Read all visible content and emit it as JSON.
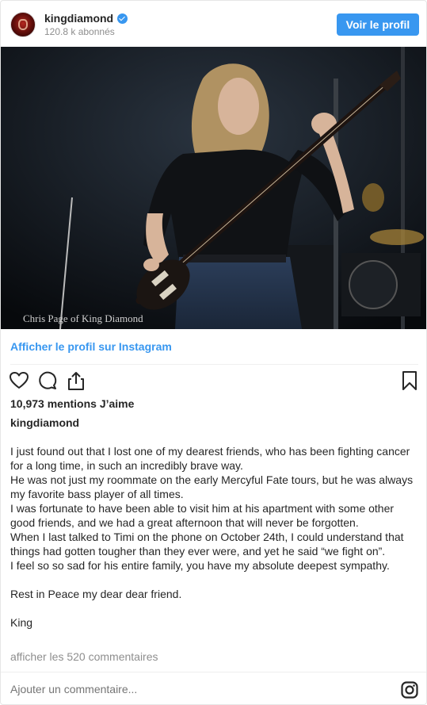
{
  "header": {
    "username": "kingdiamond",
    "followers": "120.8 k abonnés",
    "profile_button": "Voir le profil"
  },
  "photo": {
    "caption": "Chris Page of King Diamond"
  },
  "links": {
    "view_on_instagram": "Afficher le profil sur Instagram"
  },
  "engagement": {
    "likes": "10,973 mentions J’aime"
  },
  "post": {
    "username": "kingdiamond",
    "paragraphs": [
      "I just found out that I lost one of my dearest friends, who has been fighting cancer for a long time, in such an incredibly brave way.",
      "He was not just my roommate on the early Mercyful Fate tours, but he was always my favorite bass player of all times.",
      "I was fortunate to have been able to visit him at his apartment with some other good friends, and we had a great afternoon that will never be forgotten.",
      "When I last talked to Timi on the phone on October 24th, I could understand that things had gotten tougher than they ever were, and yet he said “we fight on”.",
      "I feel so so sad for his entire family, you have my absolute deepest sympathy.",
      "Rest in Peace my dear dear friend.",
      "King"
    ],
    "view_comments": "afficher les 520 commentaires"
  },
  "comment_box": {
    "placeholder": "Ajouter un commentaire..."
  },
  "icons": {
    "verified": "verified-badge-icon",
    "like": "heart-icon",
    "comment": "comment-bubble-icon",
    "share": "share-icon",
    "save": "bookmark-icon",
    "instagram": "instagram-logo-icon"
  },
  "colors": {
    "accent": "#3897f0",
    "text": "#262626",
    "muted": "#8e8e8e",
    "border": "#efefef"
  }
}
